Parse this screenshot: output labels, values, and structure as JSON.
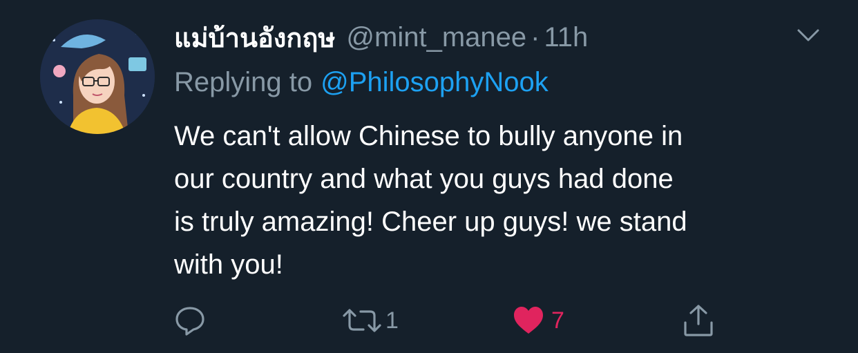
{
  "tweet": {
    "display_name": "แม่บ้านอังกฤษ",
    "handle": "@mint_manee",
    "separator": "·",
    "time": "11h",
    "replying_to_label": "Replying to",
    "replying_to_handle": "@PhilosophyNook",
    "body_lines": [
      "We can't allow Chinese to bully anyone in",
      "our country and what you guys had done",
      "is truly amazing! Cheer up guys! we stand",
      "with you!"
    ]
  },
  "actions": {
    "reply": {
      "icon": "reply-icon",
      "count": ""
    },
    "retweet": {
      "icon": "retweet-icon",
      "count": "1"
    },
    "like": {
      "icon": "heart-icon",
      "count": "7",
      "liked": true
    },
    "share": {
      "icon": "share-icon"
    }
  },
  "colors": {
    "background": "#15202b",
    "primary_text": "#ffffff",
    "secondary_text": "#8899a6",
    "link": "#1da1f2",
    "like": "#e0245e"
  }
}
